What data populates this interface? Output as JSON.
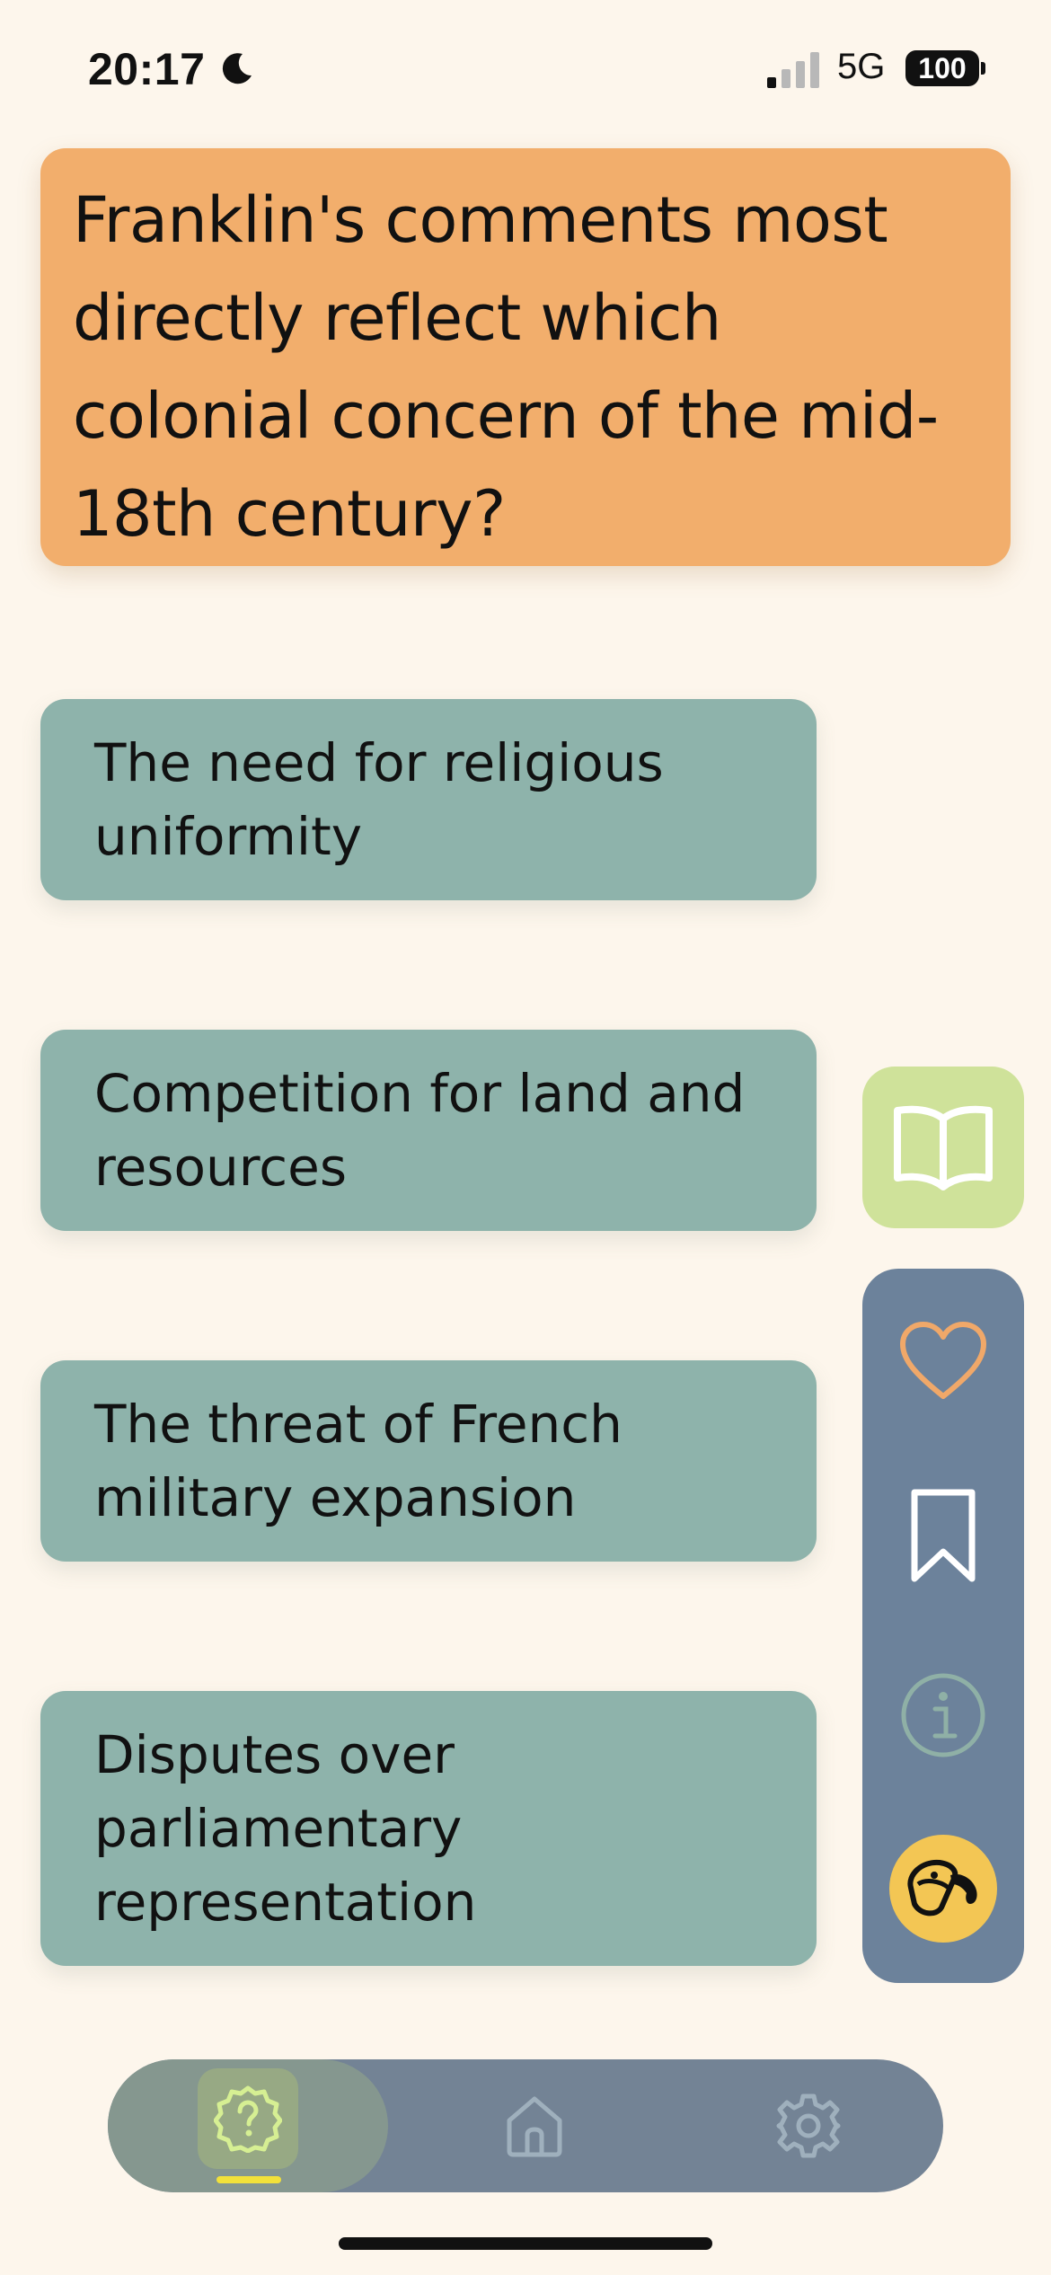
{
  "status_bar": {
    "time": "20:17",
    "network": "5G",
    "battery": "100"
  },
  "question": {
    "text": "Franklin's comments most directly reflect which colonial concern of the mid-18th century?"
  },
  "answers": [
    {
      "label": "The need for religious uniformity"
    },
    {
      "label": "Competition for land and resources"
    },
    {
      "label": "The threat of French military expansion"
    },
    {
      "label": "Disputes over parliamentary representation"
    }
  ],
  "side_panel": {
    "icons": [
      "book-icon",
      "heart-icon",
      "bookmark-icon",
      "info-icon",
      "paint-bucket-icon"
    ]
  },
  "tab_bar": {
    "tabs": [
      {
        "icon": "question-badge-icon",
        "active": true
      },
      {
        "icon": "home-icon",
        "active": false
      },
      {
        "icon": "gear-icon",
        "active": false
      }
    ]
  },
  "colors": {
    "background": "#fdf6ec",
    "question_card": "#f2ae6c",
    "answer_card": "#8eb3ab",
    "book_button": "#cfe29a",
    "side_panel": "#6c829b",
    "tab_bar": "#738395",
    "tab_indicator": "#f2e13a",
    "paint_button": "#f3c654"
  }
}
